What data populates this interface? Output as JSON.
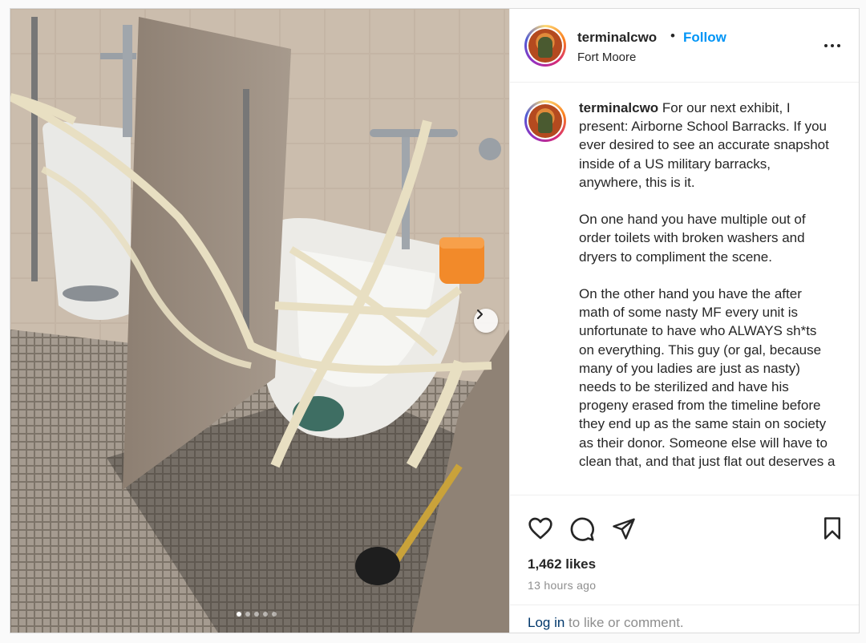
{
  "post": {
    "author": "terminalcwo",
    "separator": "•",
    "follow_label": "Follow",
    "location": "Fort Moore",
    "caption_user": "terminalcwo",
    "caption_text": " For our next exhibit, I present: Airborne School Barracks. If you ever desired to see an accurate snapshot inside of a US military barracks, anywhere, this is it.\n\nOn one hand you have multiple out of order toilets with broken washers and dryers to compliment the scene.\n\nOn the other hand you have the after math of some nasty MF every unit is unfortunate to have who ALWAYS sh*ts on everything. This guy (or gal, because many of you ladies are just as nasty) needs to be sterilized and have his progeny erased from the timeline before they end up as the same stain on society as their donor. Someone else will have to clean that, and that just flat out deserves a",
    "likes": "1,462 likes",
    "time_ago": "13 hours ago",
    "login_link": "Log in",
    "login_text": " to like or comment.",
    "carousel": {
      "total": 5,
      "active": 0
    },
    "accent_color": "#0095f6"
  }
}
